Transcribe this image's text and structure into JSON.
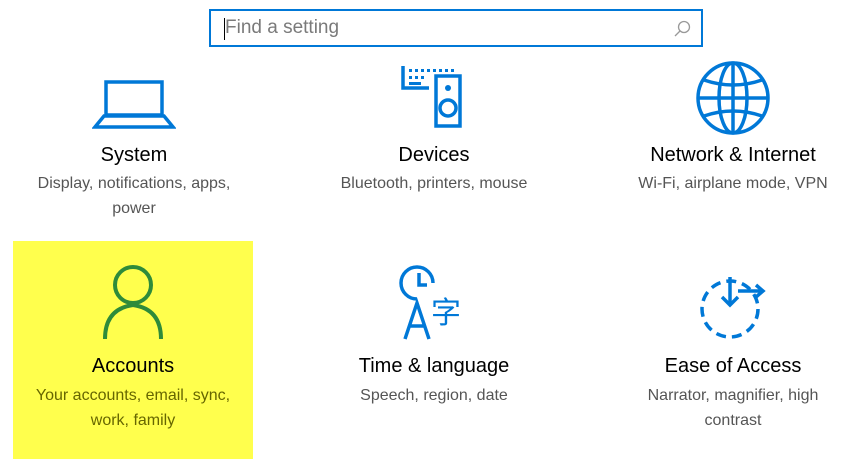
{
  "search": {
    "placeholder": "Find a setting",
    "value": ""
  },
  "tiles": [
    {
      "title": "System",
      "desc": "Display, notifications, apps, power",
      "icon": "laptop-icon"
    },
    {
      "title": "Devices",
      "desc": "Bluetooth, printers, mouse",
      "icon": "devices-icon"
    },
    {
      "title": "Network & Internet",
      "desc": "Wi-Fi, airplane mode, VPN",
      "icon": "globe-icon"
    },
    {
      "title": "Accounts",
      "desc": "Your accounts, email, sync, work, family",
      "icon": "person-icon",
      "highlighted": true
    },
    {
      "title": "Time & language",
      "desc": "Speech, region, date",
      "icon": "time-language-icon"
    },
    {
      "title": "Ease of Access",
      "desc": "Narrator, magnifier, high contrast",
      "icon": "ease-of-access-icon"
    }
  ],
  "colors": {
    "accent": "#0078d7",
    "highlight": "#ffff4d",
    "accounts_icon": "#2e8b3a"
  }
}
